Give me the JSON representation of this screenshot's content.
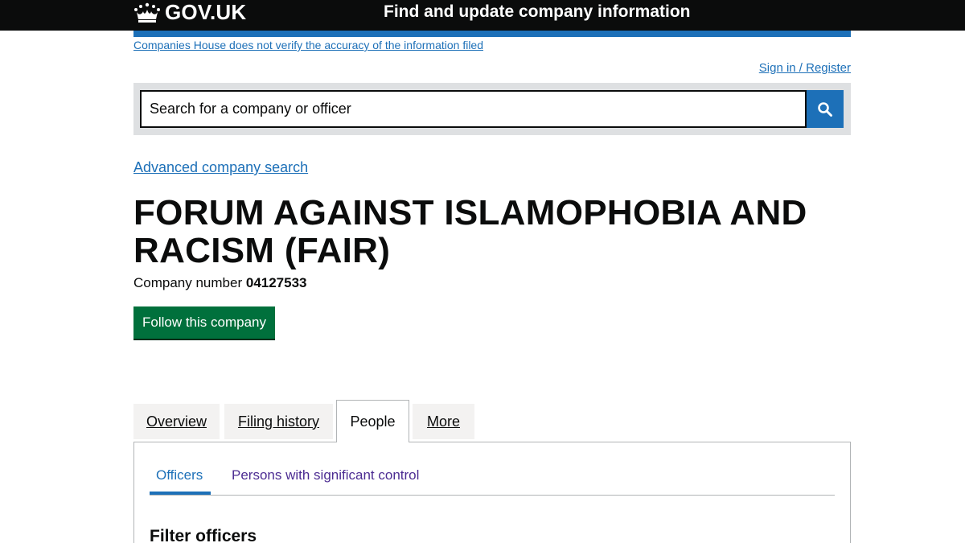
{
  "header": {
    "logo_text": "GOV.UK",
    "service_name": "Find and update company information"
  },
  "disclaimer_link": "Companies House does not verify the accuracy of the information filed",
  "signin_link": "Sign in / Register",
  "search": {
    "placeholder": "Search for a company or officer",
    "button_icon": "search-icon"
  },
  "advanced_search_link": "Advanced company search",
  "company": {
    "name": "FORUM AGAINST ISLAMOPHOBIA AND RACISM (FAIR)",
    "number_label": "Company number",
    "number": "04127533"
  },
  "follow_button": "Follow this company",
  "tabs": [
    {
      "label": "Overview",
      "active": false
    },
    {
      "label": "Filing history",
      "active": false
    },
    {
      "label": "People",
      "active": true
    },
    {
      "label": "More",
      "active": false
    }
  ],
  "subtabs": [
    {
      "label": "Officers",
      "active": true
    },
    {
      "label": "Persons with significant control",
      "active": false
    }
  ],
  "filter_heading": "Filter officers",
  "colors": {
    "header_bg": "#0b0c0c",
    "link": "#1d70b8",
    "follow_button": "#00703c",
    "visited_link": "#4c2c92"
  }
}
